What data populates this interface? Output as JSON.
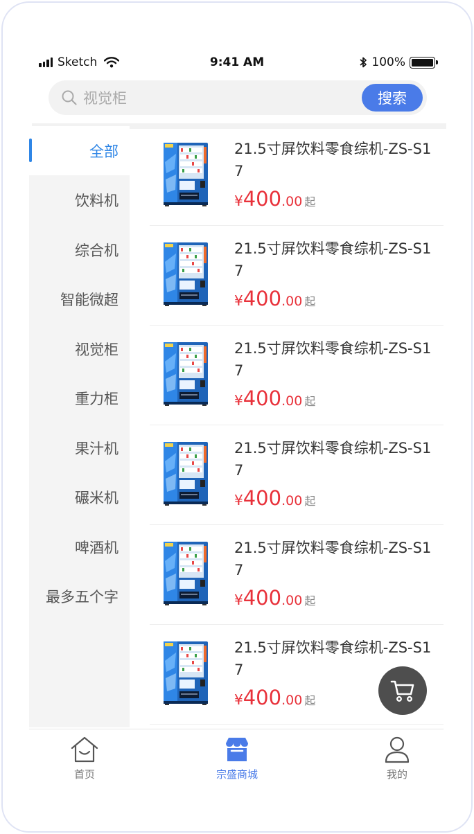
{
  "status_bar": {
    "carrier": "Sketch",
    "time": "9:41 AM",
    "battery": "100%"
  },
  "search": {
    "placeholder": "视觉柜",
    "button_label": "搜索"
  },
  "categories": [
    {
      "label": "全部",
      "active": true
    },
    {
      "label": "饮料机"
    },
    {
      "label": "综合机"
    },
    {
      "label": "智能微超"
    },
    {
      "label": "视觉柜"
    },
    {
      "label": "重力柜"
    },
    {
      "label": "果汁机"
    },
    {
      "label": "碾米机"
    },
    {
      "label": "啤酒机"
    },
    {
      "label": "最多五个字"
    }
  ],
  "products": [
    {
      "title": "21.5寸屏饮料零食综机-ZS-S17",
      "price_symbol": "¥",
      "price_int": "400",
      "price_dec": ".00",
      "price_suffix": "起"
    },
    {
      "title": "21.5寸屏饮料零食综机-ZS-S17",
      "price_symbol": "¥",
      "price_int": "400",
      "price_dec": ".00",
      "price_suffix": "起"
    },
    {
      "title": "21.5寸屏饮料零食综机-ZS-S17",
      "price_symbol": "¥",
      "price_int": "400",
      "price_dec": ".00",
      "price_suffix": "起"
    },
    {
      "title": "21.5寸屏饮料零食综机-ZS-S17",
      "price_symbol": "¥",
      "price_int": "400",
      "price_dec": ".00",
      "price_suffix": "起"
    },
    {
      "title": "21.5寸屏饮料零食综机-ZS-S17",
      "price_symbol": "¥",
      "price_int": "400",
      "price_dec": ".00",
      "price_suffix": "起"
    },
    {
      "title": "21.5寸屏饮料零食综机-ZS-S17",
      "price_symbol": "¥",
      "price_int": "400",
      "price_dec": ".00",
      "price_suffix": "起"
    }
  ],
  "tabbar": {
    "home_label": "首页",
    "mall_label": "宗盛商城",
    "mine_label": "我的"
  },
  "colors": {
    "accent": "#4a7be8",
    "category_active": "#2f86e6",
    "price": "#e8313a"
  },
  "icons": {
    "search": "search-icon",
    "cart": "cart-icon",
    "home": "home-icon",
    "mall": "store-icon",
    "mine": "user-icon"
  }
}
